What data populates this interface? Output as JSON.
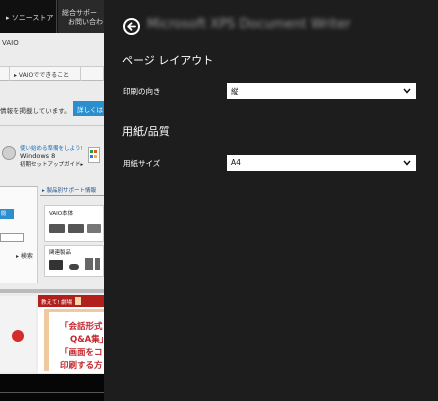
{
  "background_page": {
    "nav": {
      "store": "▸ ソニーストア",
      "support_line1": "総合サポー",
      "support_line2": "お問い合わ"
    },
    "vaio_label": "VAIO",
    "tabs": [
      "",
      "▸ VAIOでできること",
      ""
    ],
    "info_text": "情報を掲載しています。",
    "detail_button": "詳しくは",
    "win8": {
      "line1": "使い始める準備をしよう!",
      "line2": "Windows 8",
      "line3": "初期セットアップガイド▸"
    },
    "support_header": "▸ 製品別サポート情報",
    "left_button": "閲",
    "search_label": "▸ 検索",
    "vaio_main_header": "VAIO本体",
    "related_header": "関連製品",
    "red_banner": "教えて! 劇場",
    "red_lines": [
      "「会話形式",
      "Q&A集」",
      "「画面をコピ",
      "印刷する方"
    ]
  },
  "flyout": {
    "title": "Microsoft XPS Document Writer",
    "back_icon": "back-arrow-icon",
    "sections": [
      {
        "heading": "ページ レイアウト",
        "field_label": "印刷の向き",
        "value": "縦"
      },
      {
        "heading": "用紙/品質",
        "field_label": "用紙サイズ",
        "value": "A4"
      }
    ],
    "colors": {
      "background": "#1d1d1d",
      "select_bg": "#ffffff",
      "text": "#ffffff"
    }
  }
}
